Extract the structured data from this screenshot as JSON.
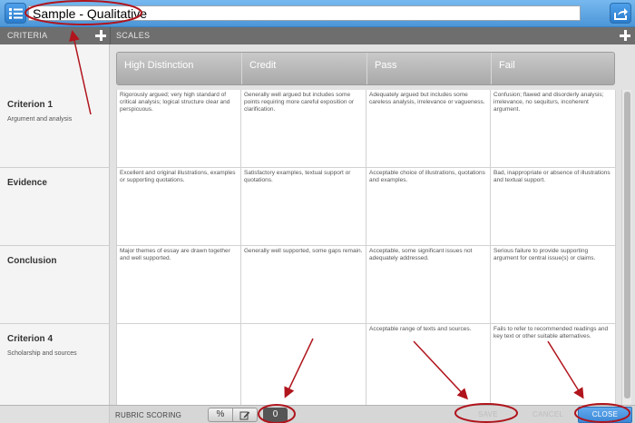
{
  "toolbar": {
    "title_value": "Sample - Qualitative",
    "list_icon": "list-icon",
    "share_icon": "share-icon"
  },
  "header": {
    "criteria_label": "CRITERIA",
    "scales_label": "SCALES"
  },
  "scales": [
    "High Distinction",
    "Credit",
    "Pass",
    "Fail"
  ],
  "criteria": [
    {
      "name": "Criterion 1",
      "description": "Argument and analysis",
      "cells": [
        "Rigorously argued; very high standard of critical analysis; logical structure clear and perspicuous.",
        "Generally well argued but includes some points requiring more careful exposition or clarification.",
        "Adequately argued but includes some careless analysis, irrelevance or vagueness.",
        "Confusion; flawed and disorderly analysis; irrelevance, no sequiturs, incoherent argument."
      ]
    },
    {
      "name": "Evidence",
      "description": "",
      "cells": [
        "Excellent and original illustrations, examples or supporting quotations.",
        "Satisfactory examples, textual support or quotations.",
        "Acceptable choice of illustrations, quotations and examples.",
        "Bad, inappropriate or absence of illustrations and textual support."
      ]
    },
    {
      "name": "Conclusion",
      "description": "",
      "cells": [
        "Major themes of essay are drawn together and well supported.",
        "Generally well supported, some gaps remain.",
        "Acceptable, some significant issues not adequately addressed.",
        "Serious failure to provide supporting argument for central issue(s) or claims."
      ]
    },
    {
      "name": "Criterion 4",
      "description": "Scholarship and sources",
      "cells": [
        "",
        "",
        "Acceptable range of texts and sources.",
        "Fails to refer to recommended readings and key text or other suitable alternatives."
      ]
    }
  ],
  "footer": {
    "rubric_scoring_label": "RUBRIC SCORING",
    "percent_label": "%",
    "score_value": "0",
    "save_label": "SAVE",
    "cancel_label": "CANCEL",
    "close_label": "CLOSE"
  },
  "colors": {
    "accent": "#4c96d8",
    "annotation": "#b0141c",
    "header_bg": "#6e6e6e"
  }
}
